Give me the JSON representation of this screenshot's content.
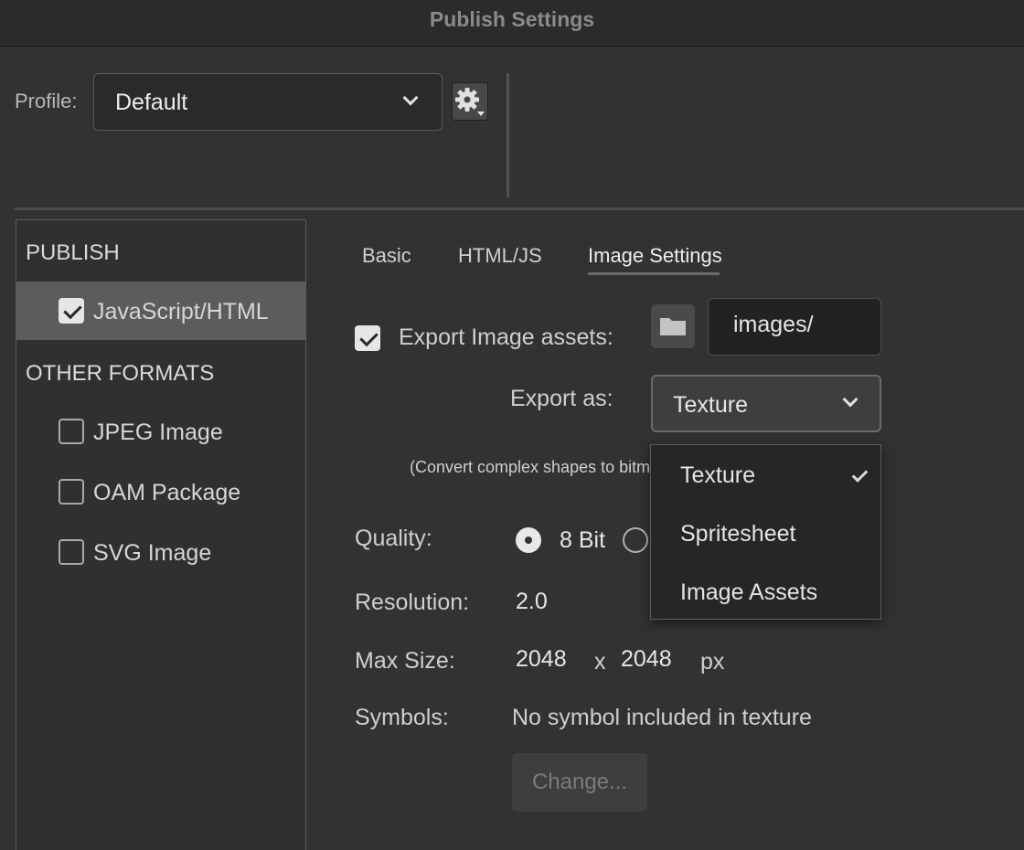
{
  "window": {
    "title": "Publish Settings"
  },
  "profile": {
    "label": "Profile:",
    "value": "Default"
  },
  "sidebar": {
    "publish_title": "PUBLISH",
    "publish_items": [
      {
        "label": "JavaScript/HTML",
        "checked": true
      }
    ],
    "other_title": "OTHER FORMATS",
    "other_items": [
      {
        "label": "JPEG Image",
        "checked": false
      },
      {
        "label": "OAM Package",
        "checked": false
      },
      {
        "label": "SVG Image",
        "checked": false
      }
    ]
  },
  "tabs": [
    {
      "label": "Basic",
      "active": false
    },
    {
      "label": "HTML/JS",
      "active": false
    },
    {
      "label": "Image Settings",
      "active": true
    }
  ],
  "image_settings": {
    "export_assets_label": "Export Image assets:",
    "export_assets_checked": true,
    "folder_path": "images/",
    "export_as_label": "Export as:",
    "export_as_value": "Texture",
    "convert_note": "(Convert complex shapes to bitm",
    "quality_label": "Quality:",
    "quality_option_8bit": "8 Bit",
    "resolution_label": "Resolution:",
    "resolution_value": "2.0",
    "max_size_label": "Max Size:",
    "max_width": "2048",
    "times": "x",
    "max_height": "2048",
    "unit": "px",
    "symbols_label": "Symbols:",
    "symbols_value": "No symbol included in texture",
    "change_button": "Change..."
  },
  "dropdown": {
    "options": [
      {
        "label": "Texture",
        "selected": true
      },
      {
        "label": "Spritesheet",
        "selected": false
      },
      {
        "label": "Image Assets",
        "selected": false
      }
    ]
  }
}
